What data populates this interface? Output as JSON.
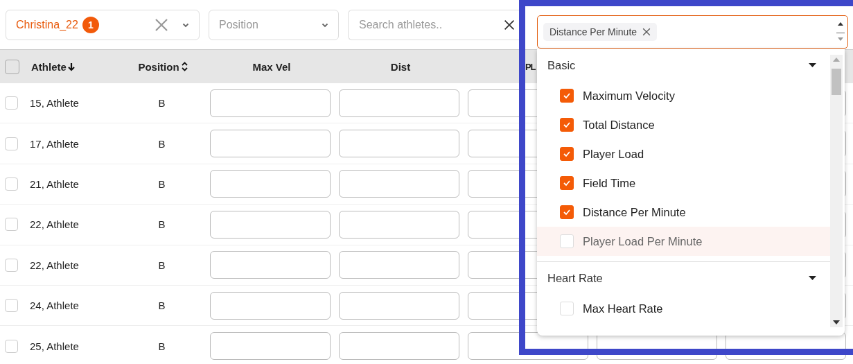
{
  "filters": {
    "athlete": {
      "value": "Christina_22",
      "badge": "1"
    },
    "position": {
      "placeholder": "Position"
    },
    "search": {
      "placeholder": "Search athletes.."
    }
  },
  "table": {
    "header_checkbox": {
      "checked": false
    },
    "columns": [
      "Athlete",
      "Position",
      "Max Vel",
      "Dist",
      "PL"
    ],
    "rows": [
      {
        "athlete": "15, Athlete",
        "position": "B",
        "checked": false
      },
      {
        "athlete": "17, Athlete",
        "position": "B",
        "checked": false
      },
      {
        "athlete": "21, Athlete",
        "position": "B",
        "checked": false
      },
      {
        "athlete": "22, Athlete",
        "position": "B",
        "checked": false
      },
      {
        "athlete": "22, Athlete",
        "position": "B",
        "checked": false
      },
      {
        "athlete": "24, Athlete",
        "position": "B",
        "checked": false
      },
      {
        "athlete": "25, Athlete",
        "position": "B",
        "checked": false
      }
    ]
  },
  "metric_picker": {
    "tags": [
      "Distance Per Minute"
    ],
    "groups": [
      {
        "label": "Basic",
        "expanded": true,
        "items": [
          {
            "label": "Maximum Velocity",
            "checked": true,
            "highlighted": false
          },
          {
            "label": "Total Distance",
            "checked": true,
            "highlighted": false
          },
          {
            "label": "Player Load",
            "checked": true,
            "highlighted": false
          },
          {
            "label": "Field Time",
            "checked": true,
            "highlighted": false
          },
          {
            "label": "Distance Per Minute",
            "checked": true,
            "highlighted": false
          },
          {
            "label": "Player Load Per Minute",
            "checked": false,
            "highlighted": true
          }
        ]
      },
      {
        "label": "Heart Rate",
        "expanded": true,
        "items": [
          {
            "label": "Max Heart Rate",
            "checked": false,
            "highlighted": false
          }
        ]
      }
    ]
  }
}
